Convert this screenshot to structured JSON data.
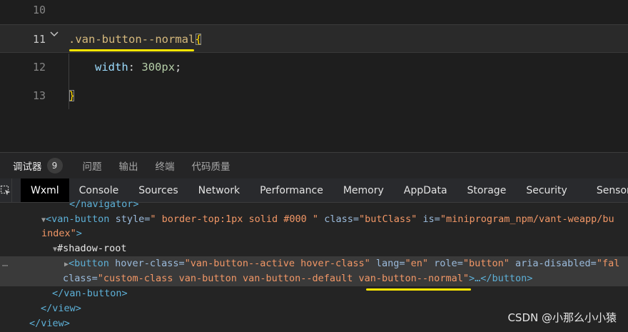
{
  "editor": {
    "lines": [
      {
        "number": "10"
      },
      {
        "number": "11"
      },
      {
        "number": "12"
      },
      {
        "number": "13"
      }
    ],
    "selector": ".van-button--normal",
    "open_brace": "{",
    "property": "width",
    "colon": ":",
    "value_number": "300",
    "value_unit": "px",
    "semicolon": ";",
    "close_brace": "}",
    "fold_icon": "chevron-down-icon",
    "highlight_color": "#ffe600"
  },
  "panel_tabs": [
    {
      "label": "调试器",
      "active": true,
      "badge": "9"
    },
    {
      "label": "问题"
    },
    {
      "label": "输出"
    },
    {
      "label": "终端"
    },
    {
      "label": "代码质量"
    }
  ],
  "devtools_tabs": [
    "Wxml",
    "Console",
    "Sources",
    "Network",
    "Performance",
    "Memory",
    "AppData",
    "Storage",
    "Security",
    "Sensor"
  ],
  "devtools_active": "Wxml",
  "tree": {
    "r0": "</navigator>",
    "r1_tag": "<van-button",
    "r1_a1": "style",
    "r1_v1": "\" border-top:1px solid #000 \"",
    "r1_a2": "class",
    "r1_v2": "\"butClass\"",
    "r1_a3": "is",
    "r1_v3": "\"miniprogram_npm/vant-weapp/bu",
    "r2_v": "index\"",
    "r2_end": ">",
    "r3": "#shadow-root",
    "r4_tag": "<button",
    "r4_a1": "hover-class",
    "r4_v1": "\"van-button--active hover-class\"",
    "r4_a2": "lang",
    "r4_v2": "\"en\"",
    "r4_a3": "role",
    "r4_v3": "\"button\"",
    "r4_a4": "aria-disabled",
    "r4_v4": "\"fal",
    "r5_a": "class",
    "r5_v": "\"custom-class van-button van-button--default van-button--normal\"",
    "r5_end": ">…</button>",
    "r6": "</van-button>",
    "r7": "</view>",
    "r8": "</view>",
    "ellipsis": "…"
  },
  "watermark": "CSDN @小那么小小猿"
}
